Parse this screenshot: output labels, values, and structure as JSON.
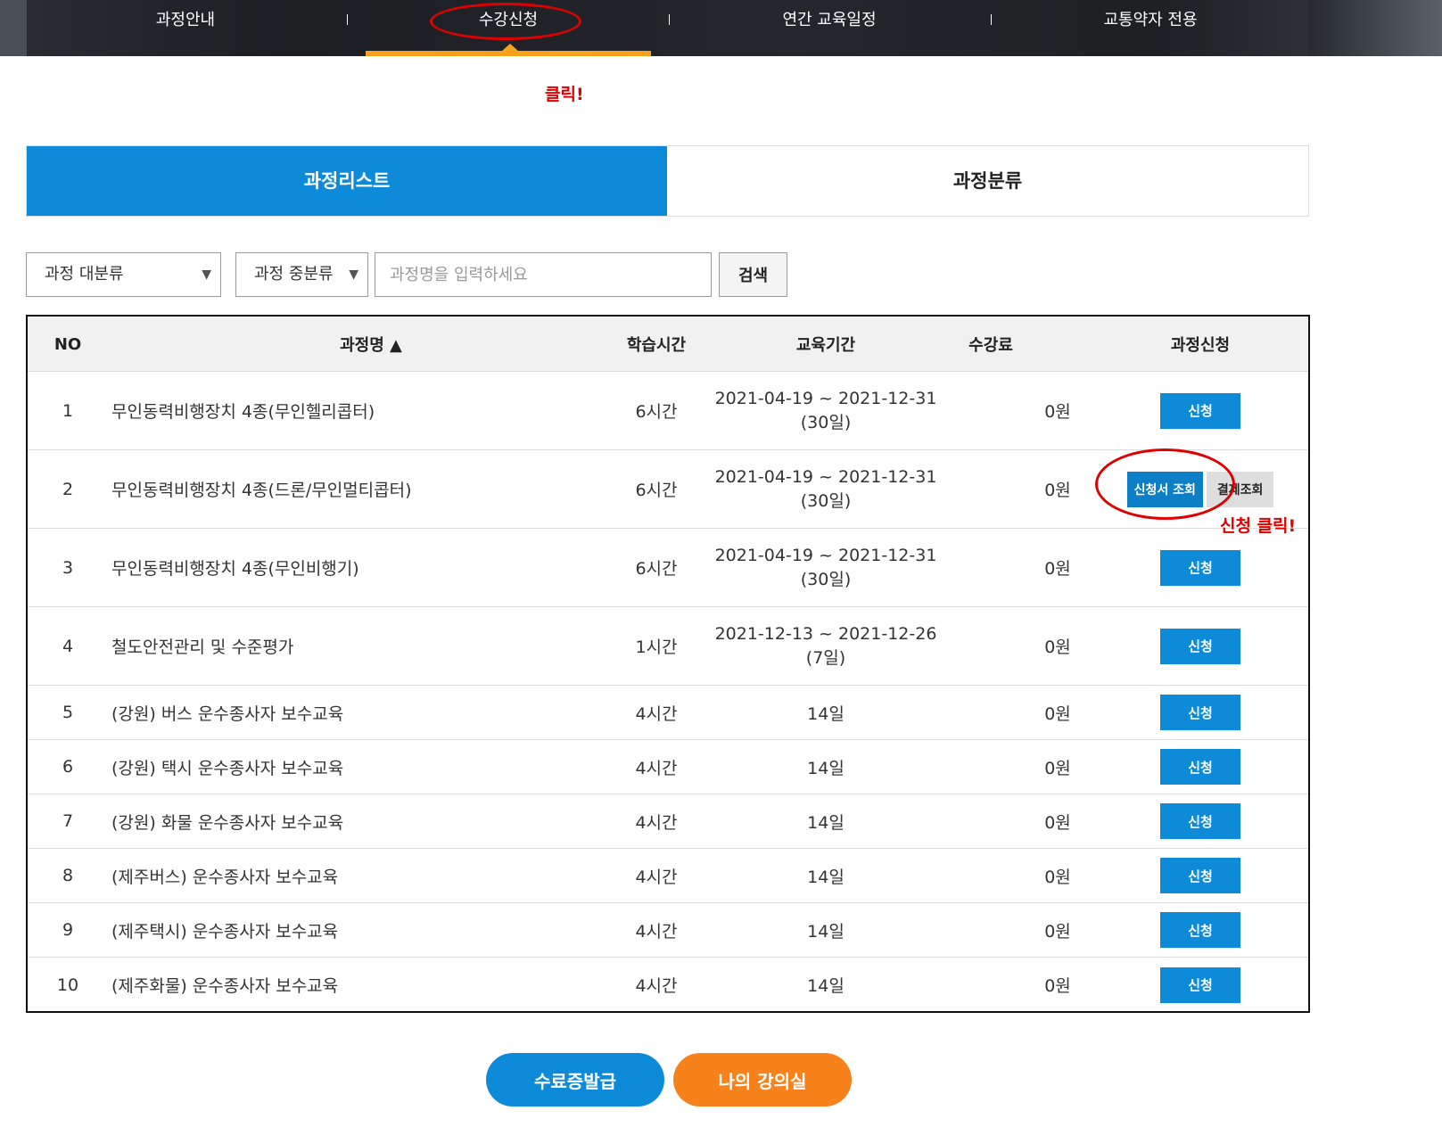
{
  "nav": {
    "items": [
      "과정안내",
      "수강신청",
      "연간 교육일정",
      "교통약자 전용"
    ],
    "active_index": 1
  },
  "annotations": {
    "nav_click": "클릭!",
    "apply_click": "신청 클릭!"
  },
  "tabs": [
    "과정리스트",
    "과정분류"
  ],
  "search": {
    "major_category": "과정 대분류",
    "middle_category": "과정 중분류",
    "placeholder": "과정명을 입력하세요",
    "button": "검색"
  },
  "table": {
    "headers": {
      "no": "NO",
      "name": "과정명 ▲",
      "hours": "학습시간",
      "period": "교육기간",
      "fee": "수강료",
      "apply": "과정신청"
    },
    "rows": [
      {
        "no": "1",
        "name": "무인동력비행장치 4종(무인헬리콥터)",
        "hours": "6시간",
        "period": "2021-04-19 ~ 2021-12-31",
        "days": "(30일)",
        "fee": "0원",
        "action": "신청"
      },
      {
        "no": "2",
        "name": "무인동력비행장치 4종(드론/무인멀티콥터)",
        "hours": "6시간",
        "period": "2021-04-19 ~ 2021-12-31",
        "days": "(30일)",
        "fee": "0원",
        "view": "신청서 조회",
        "pay": "결제조회"
      },
      {
        "no": "3",
        "name": "무인동력비행장치 4종(무인비행기)",
        "hours": "6시간",
        "period": "2021-04-19 ~ 2021-12-31",
        "days": "(30일)",
        "fee": "0원",
        "action": "신청"
      },
      {
        "no": "4",
        "name": "철도안전관리 및 수준평가",
        "hours": "1시간",
        "period": "2021-12-13 ~ 2021-12-26",
        "days": "(7일)",
        "fee": "0원",
        "action": "신청"
      },
      {
        "no": "5",
        "name": "(강원) 버스 운수종사자 보수교육",
        "hours": "4시간",
        "period": "14일",
        "fee": "0원",
        "action": "신청"
      },
      {
        "no": "6",
        "name": "(강원) 택시 운수종사자 보수교육",
        "hours": "4시간",
        "period": "14일",
        "fee": "0원",
        "action": "신청"
      },
      {
        "no": "7",
        "name": "(강원) 화물 운수종사자 보수교육",
        "hours": "4시간",
        "period": "14일",
        "fee": "0원",
        "action": "신청"
      },
      {
        "no": "8",
        "name": "(제주버스) 운수종사자 보수교육",
        "hours": "4시간",
        "period": "14일",
        "fee": "0원",
        "action": "신청"
      },
      {
        "no": "9",
        "name": "(제주택시) 운수종사자 보수교육",
        "hours": "4시간",
        "period": "14일",
        "fee": "0원",
        "action": "신청"
      },
      {
        "no": "10",
        "name": "(제주화물) 운수종사자 보수교육",
        "hours": "4시간",
        "period": "14일",
        "fee": "0원",
        "action": "신청"
      }
    ]
  },
  "bottom_buttons": {
    "certificate": "수료증발급",
    "my_classroom": "나의 강의실"
  },
  "colors": {
    "primary_blue": "#0d8bd9",
    "orange": "#f7821b",
    "annotation_red": "#e00000"
  }
}
